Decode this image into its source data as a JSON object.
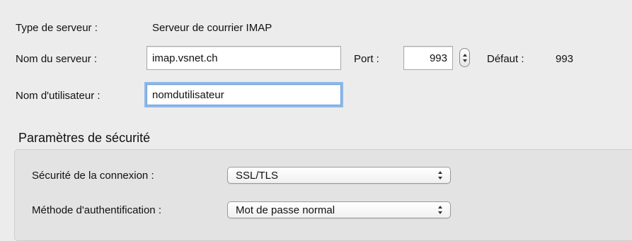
{
  "server": {
    "type_label": "Type de serveur :",
    "type_value": "Serveur de courrier IMAP",
    "name_label": "Nom du serveur :",
    "name_value": "imap.vsnet.ch",
    "port_label": "Port :",
    "port_value": "993",
    "default_label": "Défaut :",
    "default_value": "993",
    "user_label": "Nom d'utilisateur :",
    "user_value": "nomdutilisateur"
  },
  "security": {
    "title": "Paramètres de sécurité",
    "connection_label": "Sécurité de la connexion :",
    "connection_value": "SSL/TLS",
    "auth_label": "Méthode d'authentification :",
    "auth_value": "Mot de passe normal"
  },
  "icons": {
    "stepper": "up-down-stepper-icon",
    "popup": "updown-chevrons-icon"
  },
  "colors": {
    "focus_ring": "#8fb8ec",
    "window_bg": "#ececec"
  }
}
